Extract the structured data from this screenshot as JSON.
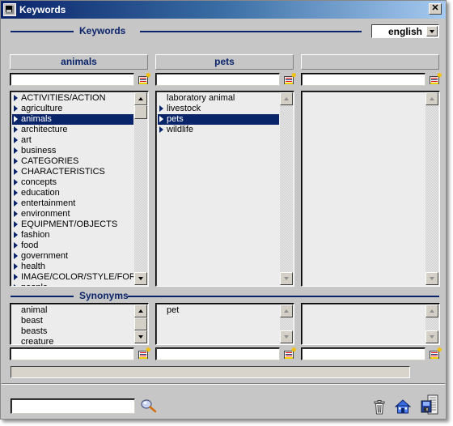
{
  "window": {
    "title": "Keywords",
    "close_label": "✕"
  },
  "keywords_section": {
    "title": "Keywords"
  },
  "language": {
    "selected": "english"
  },
  "columns": [
    {
      "header": "animals",
      "search_value": "",
      "items": [
        {
          "label": "ACTIVITIES/ACTION",
          "expandable": true
        },
        {
          "label": "agriculture",
          "expandable": true
        },
        {
          "label": "animals",
          "expandable": true,
          "selected": true
        },
        {
          "label": "architecture",
          "expandable": true
        },
        {
          "label": "art",
          "expandable": true
        },
        {
          "label": "business",
          "expandable": true
        },
        {
          "label": "CATEGORIES",
          "expandable": true
        },
        {
          "label": "CHARACTERISTICS",
          "expandable": true
        },
        {
          "label": "concepts",
          "expandable": true
        },
        {
          "label": "education",
          "expandable": true
        },
        {
          "label": "entertainment",
          "expandable": true
        },
        {
          "label": "environment",
          "expandable": true
        },
        {
          "label": "EQUIPMENT/OBJECTS",
          "expandable": true
        },
        {
          "label": "fashion",
          "expandable": true
        },
        {
          "label": "food",
          "expandable": true
        },
        {
          "label": "government",
          "expandable": true
        },
        {
          "label": "health",
          "expandable": true
        },
        {
          "label": "IMAGE/COLOR/STYLE/FOR",
          "expandable": true
        },
        {
          "label": "people",
          "expandable": true
        }
      ]
    },
    {
      "header": "pets",
      "search_value": "",
      "items": [
        {
          "label": "laboratory animal",
          "expandable": false
        },
        {
          "label": "livestock",
          "expandable": true
        },
        {
          "label": "pets",
          "expandable": true,
          "selected": true
        },
        {
          "label": "wildlife",
          "expandable": true
        }
      ]
    },
    {
      "header": "",
      "search_value": "",
      "items": []
    }
  ],
  "synonyms_section": {
    "title": "Synonyms",
    "columns": [
      {
        "items": [
          "animal",
          "beast",
          "beasts",
          "creature"
        ],
        "input_value": ""
      },
      {
        "items": [
          "pet"
        ],
        "input_value": ""
      },
      {
        "items": [],
        "input_value": ""
      }
    ]
  },
  "status_text": "",
  "bottom": {
    "search_value": "",
    "icons": [
      "search-icon",
      "trash-icon",
      "home-icon",
      "save-icon"
    ]
  },
  "colors": {
    "accent": "#0a246a",
    "window_bg": "#c6c6c6",
    "list_bg": "#ececec",
    "selection_bg": "#0a246a",
    "new_icon_star": "#f5c000"
  }
}
